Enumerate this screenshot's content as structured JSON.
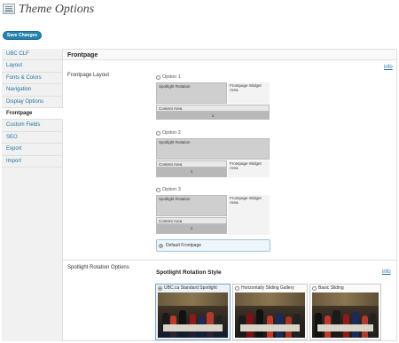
{
  "header": {
    "title": "Theme Options",
    "save_label": "Save Changes"
  },
  "sidebar": {
    "items": [
      {
        "label": "UBC CLF",
        "active": false
      },
      {
        "label": "Layout",
        "active": false
      },
      {
        "label": "Fonts & Colors",
        "active": false
      },
      {
        "label": "Navigation",
        "active": false
      },
      {
        "label": "Display Options",
        "active": false
      },
      {
        "label": "Frontpage",
        "active": true
      },
      {
        "label": "Custom Fields",
        "active": false
      },
      {
        "label": "SEO",
        "active": false
      },
      {
        "label": "Export",
        "active": false
      },
      {
        "label": "Import",
        "active": false
      }
    ]
  },
  "main": {
    "section_title": "Frontpage",
    "info_label": "info",
    "layout": {
      "label": "Frontpage Layout",
      "option1": {
        "label": "Option 1",
        "spotlight": "Spotlight Rotation",
        "widget": "Frontpage Widget Area",
        "content": "Content Area",
        "num": "1"
      },
      "option2": {
        "label": "Option 2",
        "spotlight": "Spotlight Rotation",
        "content": "Content Area",
        "num": "1",
        "widget": "Frontpage Widget Area"
      },
      "option3": {
        "label": "Option 3",
        "spotlight": "Spotlight Rotation",
        "widget": "Frontpage Widget Area",
        "content": "Content Area",
        "num": "1"
      },
      "default_label": "Default Frontpage"
    },
    "spotlight": {
      "label": "Spotlight Rotation Options",
      "style_title": "Spotlight Rotation Style",
      "info_label": "info",
      "options": [
        {
          "label": "UBC.ca Standard Spotlight",
          "selected": true
        },
        {
          "label": "Horizontally Sliding Gallery",
          "selected": false
        },
        {
          "label": "Basic Sliding",
          "selected": false
        }
      ]
    }
  },
  "colors": {
    "accent": "#2583ad",
    "link": "#21759b",
    "block": "#cfcfcf"
  }
}
